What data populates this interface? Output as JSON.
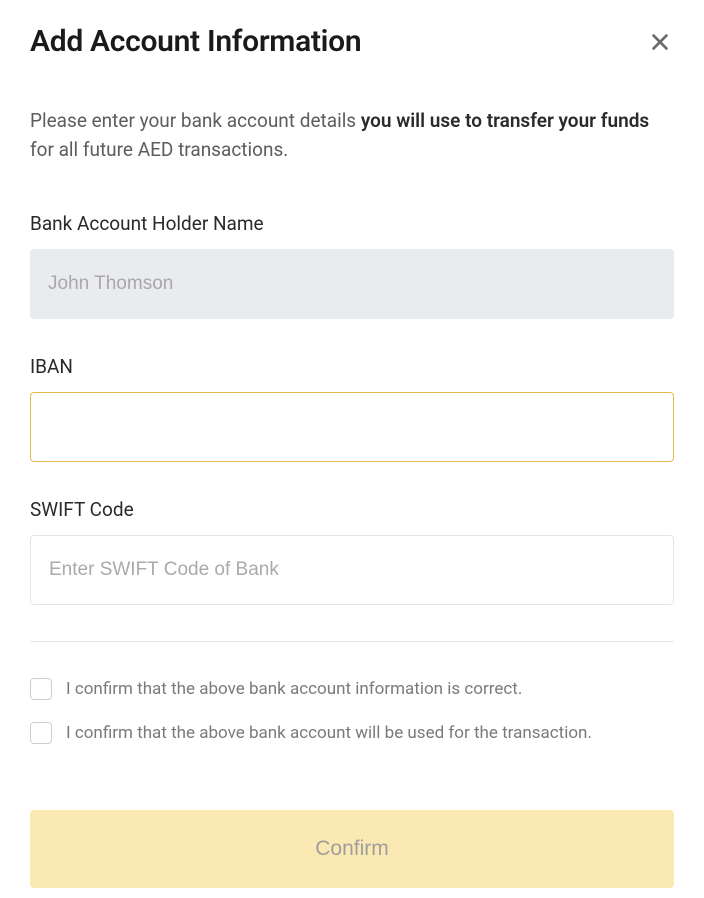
{
  "header": {
    "title": "Add Account Information"
  },
  "description": {
    "prefix": "Please enter your bank account details ",
    "bold": "you will use to transfer your funds",
    "suffix": " for all future AED transactions."
  },
  "fields": {
    "holder_name": {
      "label": "Bank Account Holder Name",
      "value": "John Thomson"
    },
    "iban": {
      "label": "IBAN",
      "value": ""
    },
    "swift": {
      "label": "SWIFT Code",
      "placeholder": "Enter SWIFT Code of Bank",
      "value": ""
    }
  },
  "checkboxes": {
    "confirm_info": "I confirm that the above bank account information is correct.",
    "confirm_use": "I confirm that the above bank account will be used for the transaction."
  },
  "actions": {
    "confirm": "Confirm"
  }
}
